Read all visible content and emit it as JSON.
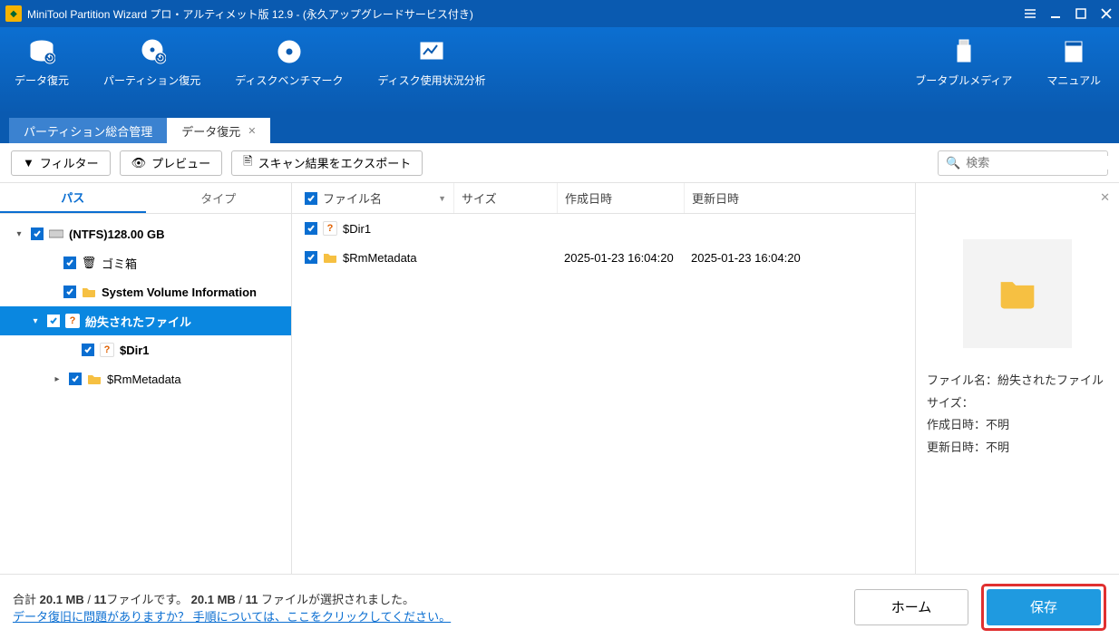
{
  "titlebar": {
    "title": "MiniTool Partition Wizard プロ・アルティメット版 12.9 - (永久アップグレードサービス付き)"
  },
  "ribbon": {
    "items": [
      {
        "label": "データ復元"
      },
      {
        "label": "パーティション復元"
      },
      {
        "label": "ディスクベンチマーク"
      },
      {
        "label": "ディスク使用状況分析"
      }
    ],
    "right": [
      {
        "label": "ブータブルメディア"
      },
      {
        "label": "マニュアル"
      }
    ]
  },
  "tabs": {
    "items": [
      {
        "label": "パーティション総合管理",
        "active": false
      },
      {
        "label": "データ復元",
        "active": true
      }
    ]
  },
  "toolbar": {
    "filter": "フィルター",
    "preview": "プレビュー",
    "export": "スキャン結果をエクスポート",
    "search_placeholder": "検索"
  },
  "leftpane": {
    "tabs": {
      "path": "パス",
      "type": "タイプ"
    },
    "tree": {
      "root": {
        "label": "(NTFS)128.00 GB"
      },
      "children": [
        {
          "label": "ゴミ箱"
        },
        {
          "label": "System Volume Information"
        },
        {
          "label": "紛失されたファイル",
          "selected": true,
          "children": [
            {
              "label": "$Dir1"
            },
            {
              "label": "$RmMetadata"
            }
          ]
        }
      ]
    }
  },
  "table": {
    "headers": {
      "name": "ファイル名",
      "size": "サイズ",
      "created": "作成日時",
      "modified": "更新日時"
    },
    "rows": [
      {
        "name": "$Dir1",
        "size": "",
        "created": "",
        "modified": "",
        "icon": "unknown"
      },
      {
        "name": "$RmMetadata",
        "size": "",
        "created": "2025-01-23 16:04:20",
        "modified": "2025-01-23 16:04:20",
        "icon": "folder"
      }
    ]
  },
  "details": {
    "filename_k": "ファイル名：",
    "filename_v": "紛失されたファイル",
    "size_k": "サイズ：",
    "size_v": "",
    "created_k": "作成日時：",
    "created_v": "不明",
    "modified_k": "更新日時：",
    "modified_v": "不明"
  },
  "footer": {
    "line1_a": "合計 ",
    "line1_b": "20.1 MB",
    "line1_c": " / ",
    "line1_d": "11",
    "line1_e": "ファイルです。 ",
    "line1_f": "20.1 MB",
    "line1_g": " / ",
    "line1_h": "11",
    "line1_i": " ファイルが選択されました。",
    "link": "データ復旧に問題がありますか？ 手順については、ここをクリックしてください。",
    "home": "ホーム",
    "save": "保存"
  }
}
